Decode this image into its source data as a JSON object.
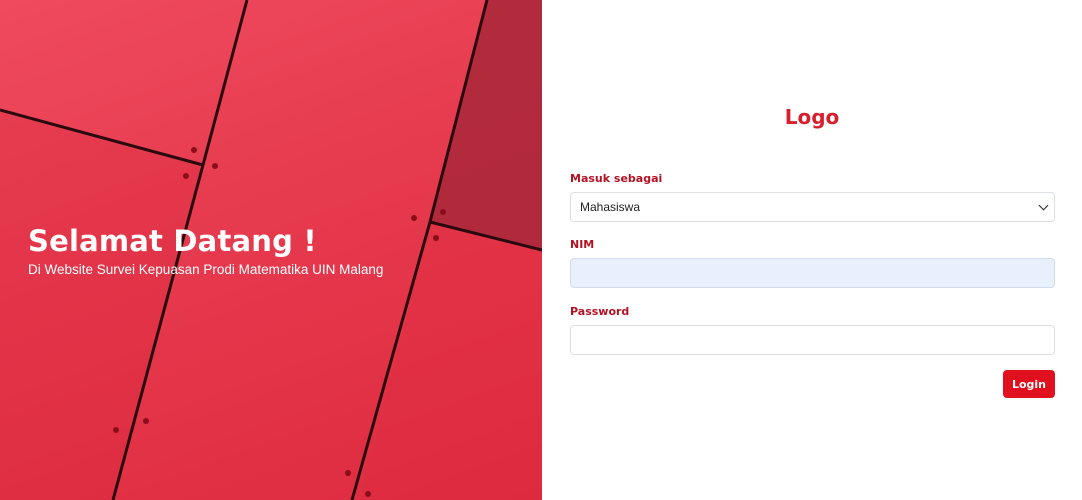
{
  "hero": {
    "title": "Selamat Datang !",
    "subtitle": "Di Website Survei Kepuasan Prodi Matematika UIN Malang"
  },
  "form": {
    "logo": "Logo",
    "role_label": "Masuk sebagai",
    "role_value": "Mahasiswa",
    "nim_label": "NIM",
    "nim_value": "",
    "password_label": "Password",
    "password_value": "",
    "login_label": "Login"
  },
  "colors": {
    "brand_red": "#e0101e",
    "label_red": "#b31222",
    "autofill_blue": "#e8f0fe"
  },
  "icons": {
    "select_chevron": "chevron-down-icon"
  }
}
